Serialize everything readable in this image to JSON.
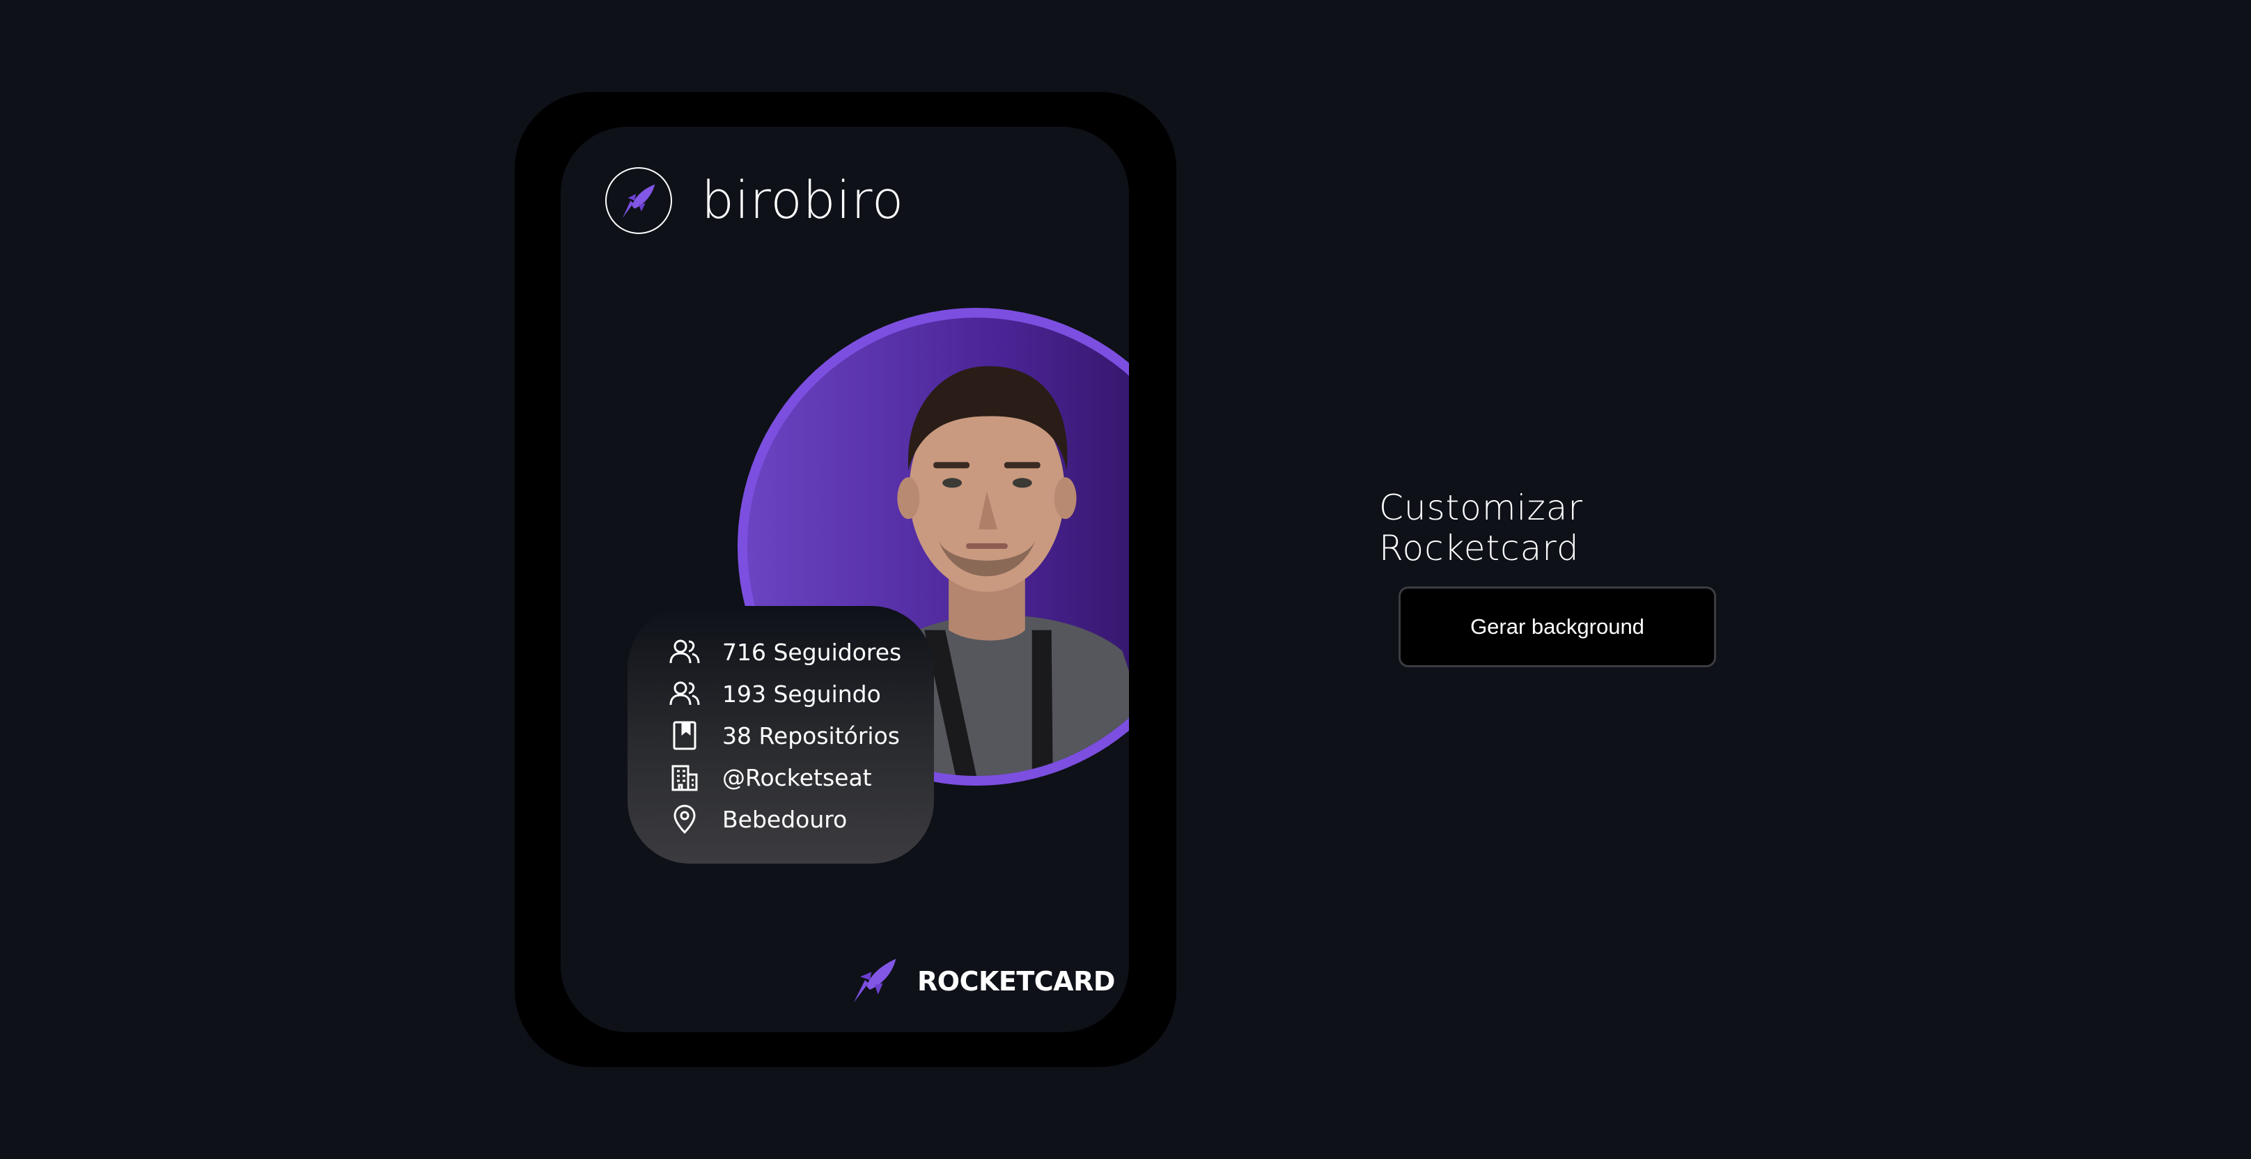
{
  "card": {
    "username": "birobiro",
    "stats": [
      {
        "icon": "followers-icon",
        "label": "716 Seguidores"
      },
      {
        "icon": "following-icon",
        "label": "193 Seguindo"
      },
      {
        "icon": "repository-icon",
        "label": "38 Repositórios"
      },
      {
        "icon": "company-icon",
        "label": "@Rocketseat"
      },
      {
        "icon": "location-icon",
        "label": "Bebedouro"
      }
    ],
    "brand": "ROCKETCARD",
    "accent_color": "#7c4fe0"
  },
  "panel": {
    "title": "Customizar Rocketcard",
    "button_label": "Gerar background"
  }
}
